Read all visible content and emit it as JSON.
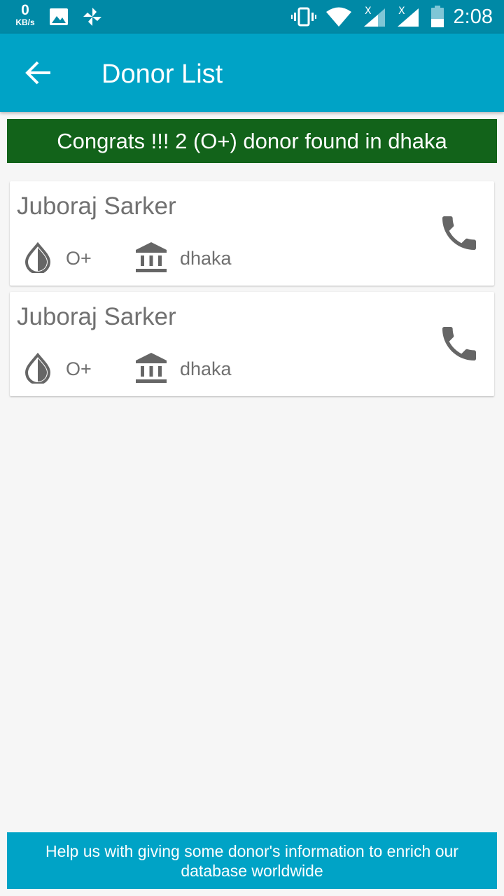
{
  "status_bar": {
    "speed_value": "0",
    "speed_unit": "KB/s",
    "time": "2:08"
  },
  "app_bar": {
    "title": "Donor List",
    "back_icon": "arrow-back-icon"
  },
  "banner": {
    "text": "Congrats !!! 2 (O+) donor found in dhaka"
  },
  "donors": [
    {
      "name": "Juboraj Sarker",
      "blood_group": "O+",
      "city": "dhaka"
    },
    {
      "name": "Juboraj Sarker",
      "blood_group": "O+",
      "city": "dhaka"
    }
  ],
  "footer": {
    "text": "Help us with giving some donor's information to enrich our database worldwide"
  },
  "colors": {
    "status_bar": "#0089a6",
    "app_bar": "#00a3c6",
    "banner": "#12631a",
    "icon_gray": "#666666"
  }
}
